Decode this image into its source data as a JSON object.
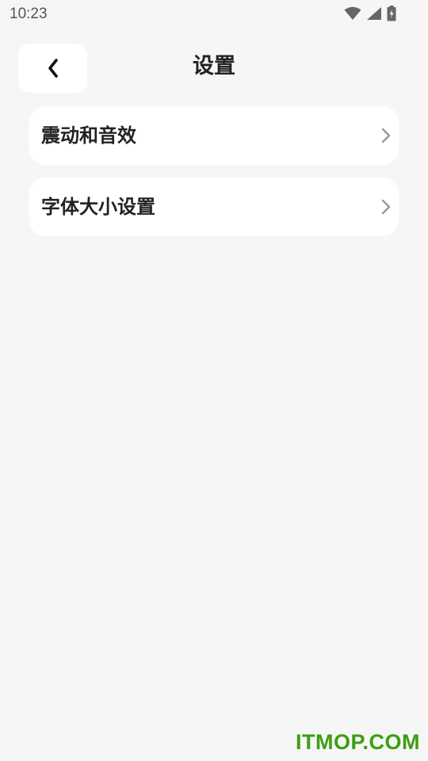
{
  "status_bar": {
    "time": "10:23",
    "icons": [
      "wifi-icon",
      "cellular-signal-icon",
      "battery-charging-icon"
    ]
  },
  "header": {
    "back_icon": "chevron-left-icon",
    "title": "设置"
  },
  "settings": {
    "items": [
      {
        "label": "震动和音效",
        "icon": "chevron-right-icon"
      },
      {
        "label": "字体大小设置",
        "icon": "chevron-right-icon"
      }
    ]
  },
  "watermark": {
    "text": "ITMOP.COM",
    "color": "#3aa00f"
  }
}
